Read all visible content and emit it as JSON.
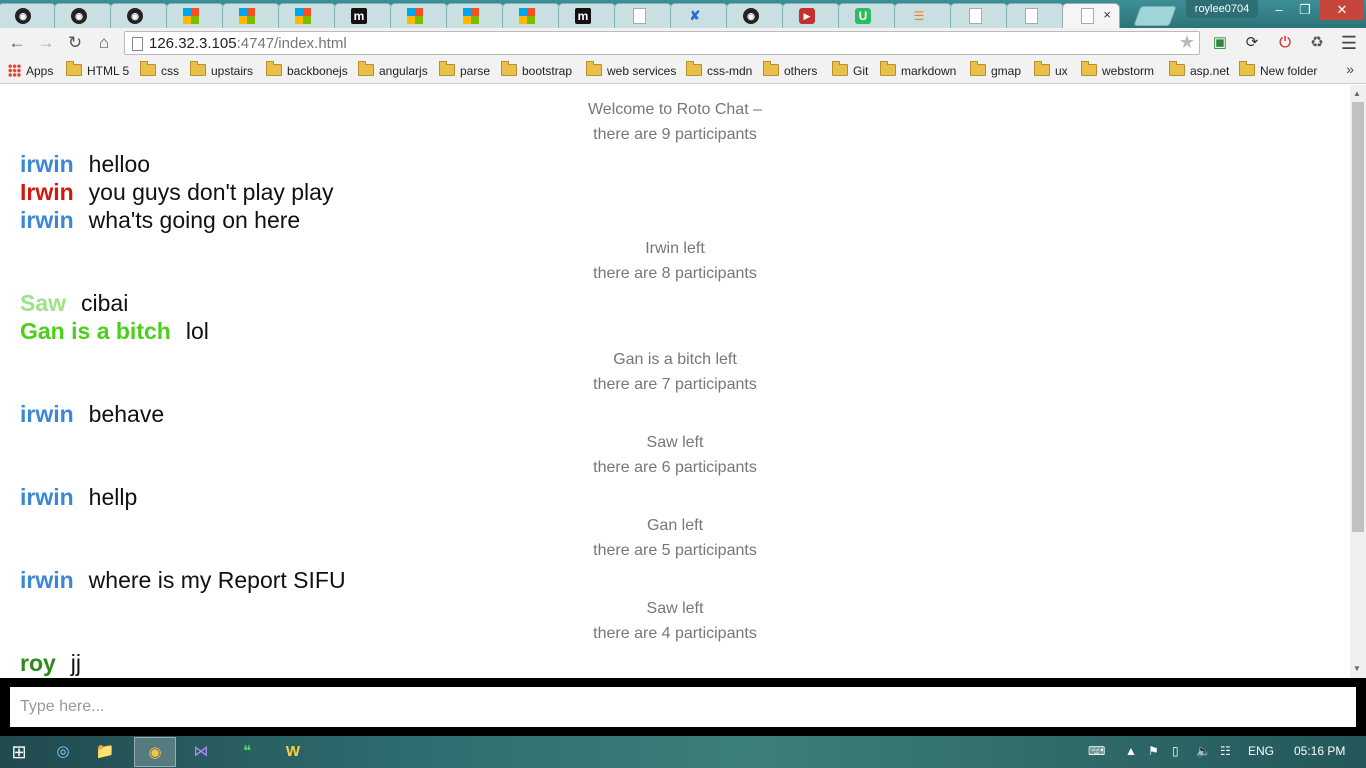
{
  "browser": {
    "profile_name": "roylee0704",
    "url_host": "126.32.3.105",
    "url_rest": ":4747/index.html",
    "tabs": [
      {
        "icon": "github-icon"
      },
      {
        "icon": "github-icon"
      },
      {
        "icon": "github-icon"
      },
      {
        "icon": "microsoft-icon"
      },
      {
        "icon": "microsoft-icon"
      },
      {
        "icon": "microsoft-icon"
      },
      {
        "icon": "medium-icon"
      },
      {
        "icon": "microsoft-icon"
      },
      {
        "icon": "microsoft-icon"
      },
      {
        "icon": "microsoft-icon"
      },
      {
        "icon": "medium-icon"
      },
      {
        "icon": "document-icon"
      },
      {
        "icon": "tool-icon"
      },
      {
        "icon": "github-icon"
      },
      {
        "icon": "youtube-icon"
      },
      {
        "icon": "upwork-icon"
      },
      {
        "icon": "stackoverflow-icon"
      },
      {
        "icon": "document-icon"
      },
      {
        "icon": "document-icon"
      },
      {
        "icon": "document-icon",
        "active": true
      }
    ],
    "active_tab_close": "×"
  },
  "bookmarks": {
    "apps": "Apps",
    "items": [
      "HTML 5",
      "css",
      "upstairs",
      "backbonejs",
      "angularjs",
      "parse",
      "bootstrap",
      "web services",
      "css-mdn",
      "others",
      "Git",
      "markdown",
      "gmap",
      "ux",
      "webstorm",
      "asp.net",
      "New folder"
    ],
    "more": "»"
  },
  "chat": {
    "welcome": "Welcome to Roto Chat –",
    "welcome_count": "there are 9 participants",
    "messages": [
      {
        "user": "irwin",
        "text": "helloo",
        "color": "#3b87d8"
      },
      {
        "user": "Irwin",
        "text": "you guys don't play play",
        "color": "#d0190f"
      },
      {
        "user": "irwin",
        "text": "wha'ts going on here",
        "color": "#3b87d8"
      },
      {
        "user": "Saw",
        "text": "cibai",
        "color": "#9ee38a"
      },
      {
        "user": "Gan is a bitch",
        "text": "lol",
        "color": "#4ccf1b"
      },
      {
        "user": "irwin",
        "text": "behave",
        "color": "#3b87d8"
      },
      {
        "user": "irwin",
        "text": "hellp",
        "color": "#3b87d8"
      },
      {
        "user": "irwin",
        "text": "where is my Report SIFU",
        "color": "#3b87d8"
      },
      {
        "user": "roy",
        "text": "jj",
        "color": "#2b8a18"
      }
    ],
    "events": [
      {
        "left": "Irwin left",
        "count": "there are 8 participants"
      },
      {
        "left": "Gan is a bitch left",
        "count": "there are 7 participants"
      },
      {
        "left": "Saw left",
        "count": "there are 6 participants"
      },
      {
        "left": "Gan left",
        "count": "there are 5 participants"
      },
      {
        "left": "Saw left",
        "count": "there are 4 participants"
      }
    ]
  },
  "input": {
    "placeholder": "Type here..."
  },
  "taskbar": {
    "language": "ENG",
    "time": "05:16 PM"
  }
}
